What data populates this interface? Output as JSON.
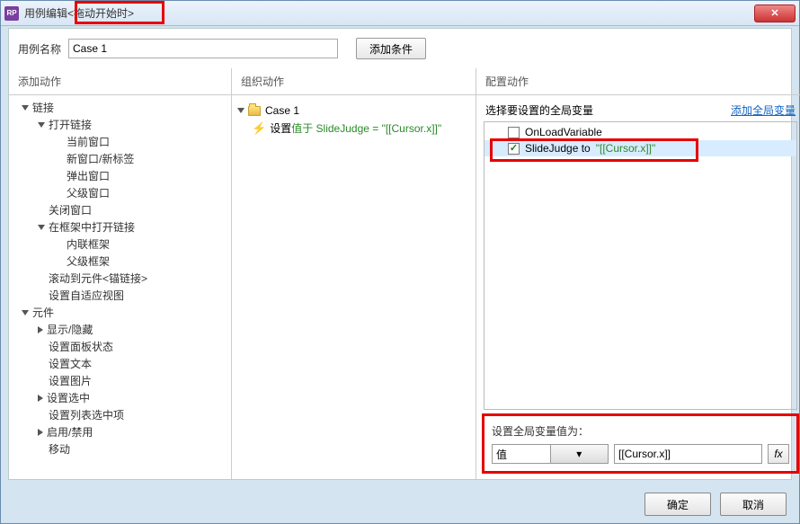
{
  "title": {
    "prefix": "用例编辑",
    "highlighted": "<拖动开始时>"
  },
  "nameRow": {
    "label": "用例名称",
    "value": "Case 1",
    "conditionBtn": "添加条件"
  },
  "panels": {
    "left": "添加动作",
    "mid": "组织动作",
    "right": "配置动作"
  },
  "leftTree": [
    {
      "lvl": 1,
      "arrow": "exp",
      "label": "链接"
    },
    {
      "lvl": 2,
      "arrow": "exp",
      "label": "打开链接"
    },
    {
      "lvl": 3,
      "arrow": "none",
      "label": "当前窗口"
    },
    {
      "lvl": 3,
      "arrow": "none",
      "label": "新窗口/新标签"
    },
    {
      "lvl": 3,
      "arrow": "none",
      "label": "弹出窗口"
    },
    {
      "lvl": 3,
      "arrow": "none",
      "label": "父级窗口"
    },
    {
      "lvl": 2,
      "arrow": "none",
      "label": "关闭窗口"
    },
    {
      "lvl": 2,
      "arrow": "exp",
      "label": "在框架中打开链接"
    },
    {
      "lvl": 3,
      "arrow": "none",
      "label": "内联框架"
    },
    {
      "lvl": 3,
      "arrow": "none",
      "label": "父级框架"
    },
    {
      "lvl": 2,
      "arrow": "none",
      "label": "滚动到元件<锚链接>"
    },
    {
      "lvl": 2,
      "arrow": "none",
      "label": "设置自适应视图"
    },
    {
      "lvl": 1,
      "arrow": "exp",
      "label": "元件"
    },
    {
      "lvl": 2,
      "arrow": "col",
      "label": "显示/隐藏"
    },
    {
      "lvl": 2,
      "arrow": "none",
      "label": "设置面板状态"
    },
    {
      "lvl": 2,
      "arrow": "none",
      "label": "设置文本"
    },
    {
      "lvl": 2,
      "arrow": "none",
      "label": "设置图片"
    },
    {
      "lvl": 2,
      "arrow": "col",
      "label": "设置选中"
    },
    {
      "lvl": 2,
      "arrow": "none",
      "label": "设置列表选中项"
    },
    {
      "lvl": 2,
      "arrow": "col",
      "label": "启用/禁用"
    },
    {
      "lvl": 2,
      "arrow": "none",
      "label": "移动"
    }
  ],
  "midTree": {
    "case": "Case 1",
    "actionPrefix": "设置 ",
    "actionGreen": "值于 SlideJudge = \"[[Cursor.x]]\""
  },
  "right": {
    "topLabel": "选择要设置的全局变量",
    "addVar": "添加全局变量",
    "vars": [
      {
        "checked": false,
        "label": "OnLoadVariable",
        "selected": false
      },
      {
        "checked": true,
        "label": "SlideJudge to ",
        "greenSuffix": "\"[[Cursor.x]]\"",
        "selected": true
      }
    ],
    "bottom": {
      "label": "设置全局变量值为：",
      "combo": "值",
      "value": "[[Cursor.x]]",
      "fx": "fx"
    }
  },
  "footer": {
    "ok": "确定",
    "cancel": "取消"
  }
}
